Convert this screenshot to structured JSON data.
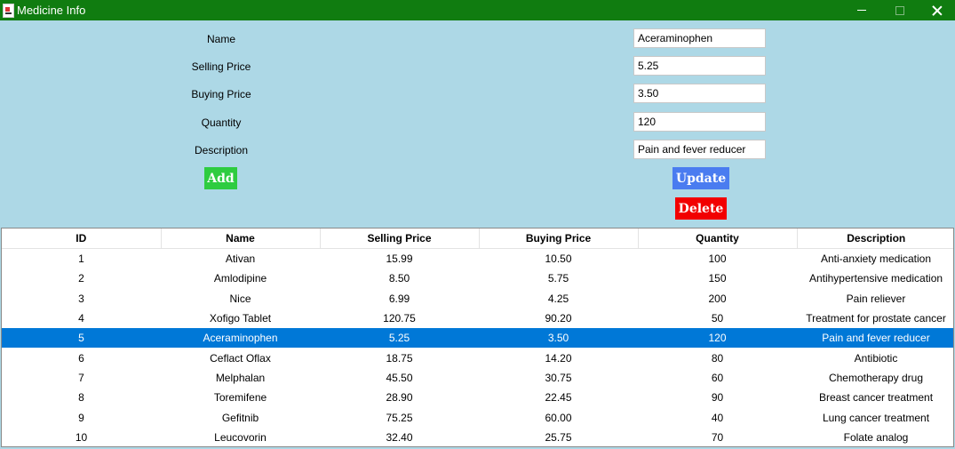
{
  "window": {
    "title": "Medicine Info"
  },
  "form": {
    "labels": {
      "name": "Name",
      "selling_price": "Selling Price",
      "buying_price": "Buying Price",
      "quantity": "Quantity",
      "description": "Description"
    },
    "values": {
      "name": "Aceraminophen",
      "selling_price": "5.25",
      "buying_price": "3.50",
      "quantity": "120",
      "description": "Pain and fever reducer"
    },
    "buttons": {
      "add": "Add",
      "update": "Update",
      "delete": "Delete"
    }
  },
  "table": {
    "headers": [
      "ID",
      "Name",
      "Selling Price",
      "Buying Price",
      "Quantity",
      "Description"
    ],
    "selected_row": 4,
    "rows": [
      [
        "1",
        "Ativan",
        "15.99",
        "10.50",
        "100",
        "Anti-anxiety medication"
      ],
      [
        "2",
        "Amlodipine",
        "8.50",
        "5.75",
        "150",
        "Antihypertensive medication"
      ],
      [
        "3",
        "Nice",
        "6.99",
        "4.25",
        "200",
        "Pain reliever"
      ],
      [
        "4",
        "Xofigo Tablet",
        "120.75",
        "90.20",
        "50",
        "Treatment for prostate cancer"
      ],
      [
        "5",
        "Aceraminophen",
        "5.25",
        "3.50",
        "120",
        "Pain and fever reducer"
      ],
      [
        "6",
        "Ceflact Oflax",
        "18.75",
        "14.20",
        "80",
        "Antibiotic"
      ],
      [
        "7",
        "Melphalan",
        "45.50",
        "30.75",
        "60",
        "Chemotherapy drug"
      ],
      [
        "8",
        "Toremifene",
        "28.90",
        "22.45",
        "90",
        "Breast cancer treatment"
      ],
      [
        "9",
        "Gefitnib",
        "75.25",
        "60.00",
        "40",
        "Lung cancer treatment"
      ],
      [
        "10",
        "Leucovorin",
        "32.40",
        "25.75",
        "70",
        "Folate analog"
      ]
    ]
  },
  "colors": {
    "titlebar": "#107c10",
    "background": "#add8e6",
    "add": "#2ecc40",
    "update": "#4a7cf0",
    "delete": "#f20000",
    "selection": "#0078d7"
  }
}
